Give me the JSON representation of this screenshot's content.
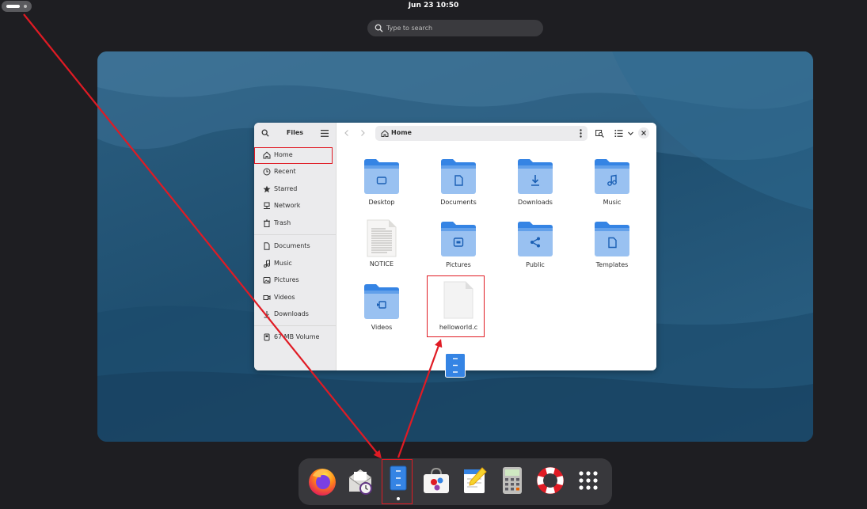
{
  "topbar": {
    "clock": "Jun 23  10:50",
    "search_placeholder": "Type to search"
  },
  "files_window": {
    "title": "Files",
    "path": "Home",
    "sidebar": {
      "places": [
        {
          "label": "Home",
          "icon": "home-icon"
        },
        {
          "label": "Recent",
          "icon": "clock-icon"
        },
        {
          "label": "Starred",
          "icon": "star-icon"
        },
        {
          "label": "Network",
          "icon": "network-icon"
        },
        {
          "label": "Trash",
          "icon": "trash-icon"
        }
      ],
      "bookmarks": [
        {
          "label": "Documents",
          "icon": "document-icon"
        },
        {
          "label": "Music",
          "icon": "music-icon"
        },
        {
          "label": "Pictures",
          "icon": "picture-icon"
        },
        {
          "label": "Videos",
          "icon": "video-icon"
        },
        {
          "label": "Downloads",
          "icon": "download-icon"
        }
      ],
      "devices": [
        {
          "label": "67 MB Volume",
          "icon": "drive-icon"
        }
      ]
    },
    "items": [
      {
        "label": "Desktop",
        "type": "folder",
        "emblem": "desktop"
      },
      {
        "label": "Documents",
        "type": "folder",
        "emblem": "documents"
      },
      {
        "label": "Downloads",
        "type": "folder",
        "emblem": "downloads"
      },
      {
        "label": "Music",
        "type": "folder",
        "emblem": "music"
      },
      {
        "label": "NOTICE",
        "type": "text-file"
      },
      {
        "label": "Pictures",
        "type": "folder",
        "emblem": "pictures"
      },
      {
        "label": "Public",
        "type": "folder",
        "emblem": "public"
      },
      {
        "label": "Templates",
        "type": "folder",
        "emblem": "templates"
      },
      {
        "label": "Videos",
        "type": "folder",
        "emblem": "videos"
      },
      {
        "label": "helloworld.c",
        "type": "file"
      }
    ]
  },
  "dock": {
    "apps": [
      {
        "name": "Firefox",
        "icon": "firefox-icon"
      },
      {
        "name": "Evolution",
        "icon": "mail-clock-icon"
      },
      {
        "name": "Files",
        "icon": "files-icon",
        "running": true
      },
      {
        "name": "Software",
        "icon": "software-icon"
      },
      {
        "name": "Text Editor",
        "icon": "text-editor-icon"
      },
      {
        "name": "Calculator",
        "icon": "calculator-icon"
      },
      {
        "name": "Help",
        "icon": "help-icon"
      },
      {
        "name": "Show Apps",
        "icon": "app-grid-icon"
      }
    ]
  },
  "colors": {
    "folder": "#62a0ea",
    "folder_dark": "#3584e4",
    "annotation": "#e01b24",
    "dash": "#38383c",
    "workspace": "#245a7e"
  }
}
